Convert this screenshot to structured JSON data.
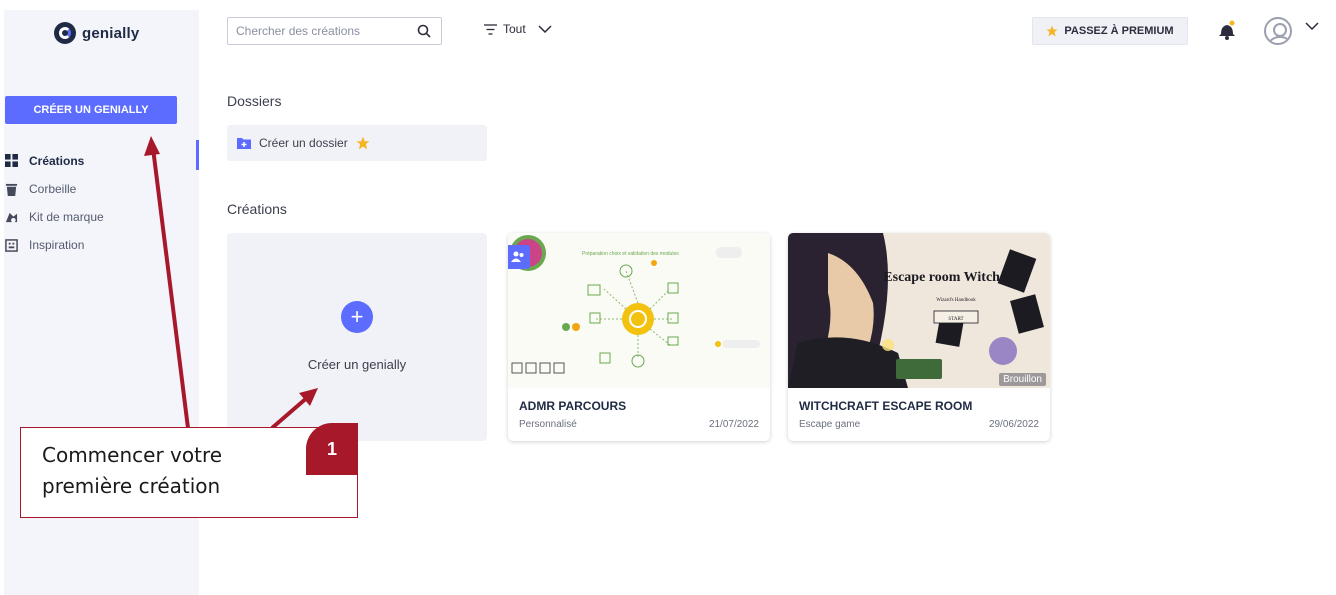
{
  "app": {
    "logo_text": "genially",
    "brand_color": "#5b6cff",
    "annotation_color": "#a8182b"
  },
  "sidebar": {
    "create_button": "CRÉER UN GENIALLY",
    "items": [
      {
        "label": "Créations",
        "icon": "grid-icon",
        "active": true
      },
      {
        "label": "Corbeille",
        "icon": "trash-icon",
        "active": false
      },
      {
        "label": "Kit de marque",
        "icon": "brand-kit-icon",
        "active": false
      },
      {
        "label": "Inspiration",
        "icon": "inspiration-icon",
        "active": false
      }
    ]
  },
  "topbar": {
    "search_placeholder": "Chercher des créations",
    "filter_label": "Tout",
    "premium_label": "PASSEZ À PREMIUM"
  },
  "main": {
    "folders_title": "Dossiers",
    "create_folder_label": "Créer un dossier",
    "creations_title": "Créations",
    "new_creation_label": "Créer un genially",
    "cards": [
      {
        "title": "ADMR PARCOURS",
        "type": "Personnalisé",
        "date": "21/07/2022",
        "badge": "",
        "thumb_heading": "Préparation choix et validation des modules"
      },
      {
        "title": "WITCHCRAFT ESCAPE ROOM",
        "type": "Escape game",
        "date": "29/06/2022",
        "badge": "Brouillon",
        "thumb_heading": "Escape room Witchcraft",
        "thumb_sub": "Wizard's Handbook",
        "thumb_button": "START"
      }
    ]
  },
  "annotation": {
    "text_line1": "Commencer votre",
    "text_line2": "première création",
    "step_number": "1"
  }
}
